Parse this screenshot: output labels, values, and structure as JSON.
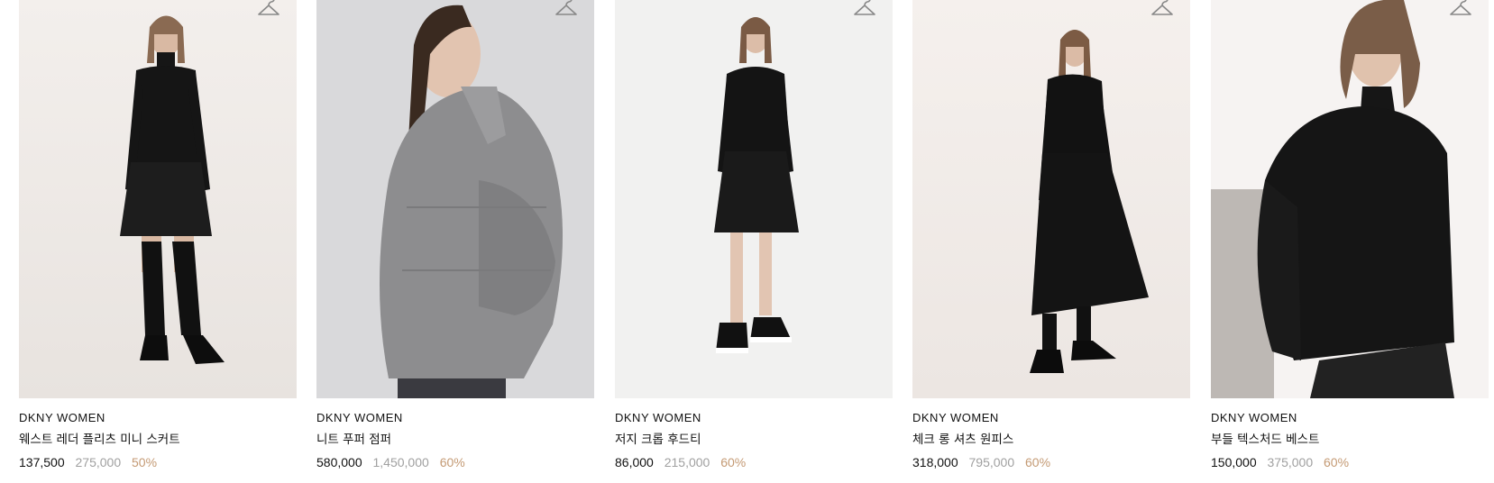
{
  "products": [
    {
      "brand": "DKNY WOMEN",
      "name": "웨스트 레더 플리츠 미니 스커트",
      "sale_price": "137,500",
      "original_price": "275,000",
      "discount": "50%",
      "image": "model in black turtleneck, pleated mini skirt and knee-high boots",
      "wishlist_icon": "hanger-icon"
    },
    {
      "brand": "DKNY WOMEN",
      "name": "니트 푸퍼 점퍼",
      "sale_price": "580,000",
      "original_price": "1,450,000",
      "discount": "60%",
      "image": "model in grey knit puffer jacket, side profile",
      "wishlist_icon": "hanger-icon"
    },
    {
      "brand": "DKNY WOMEN",
      "name": "저지 크롭 후드티",
      "sale_price": "86,000",
      "original_price": "215,000",
      "discount": "60%",
      "image": "model in black cropped hoodie, black skirt and sneakers",
      "wishlist_icon": "hanger-icon"
    },
    {
      "brand": "DKNY WOMEN",
      "name": "체크 롱 셔츠 원피스",
      "sale_price": "318,000",
      "original_price": "795,000",
      "discount": "60%",
      "image": "model in long black shirt dress with ankle boots",
      "wishlist_icon": "hanger-icon"
    },
    {
      "brand": "DKNY WOMEN",
      "name": "부들 텍스처드 베스트",
      "sale_price": "150,000",
      "original_price": "375,000",
      "discount": "60%",
      "image": "model in black textured knit vest over turtleneck",
      "wishlist_icon": "hanger-icon"
    }
  ],
  "colors": {
    "text": "#111111",
    "original_price": "#a0a0a0",
    "discount": "#c49a74",
    "photo_bg": "#eeeceb"
  }
}
